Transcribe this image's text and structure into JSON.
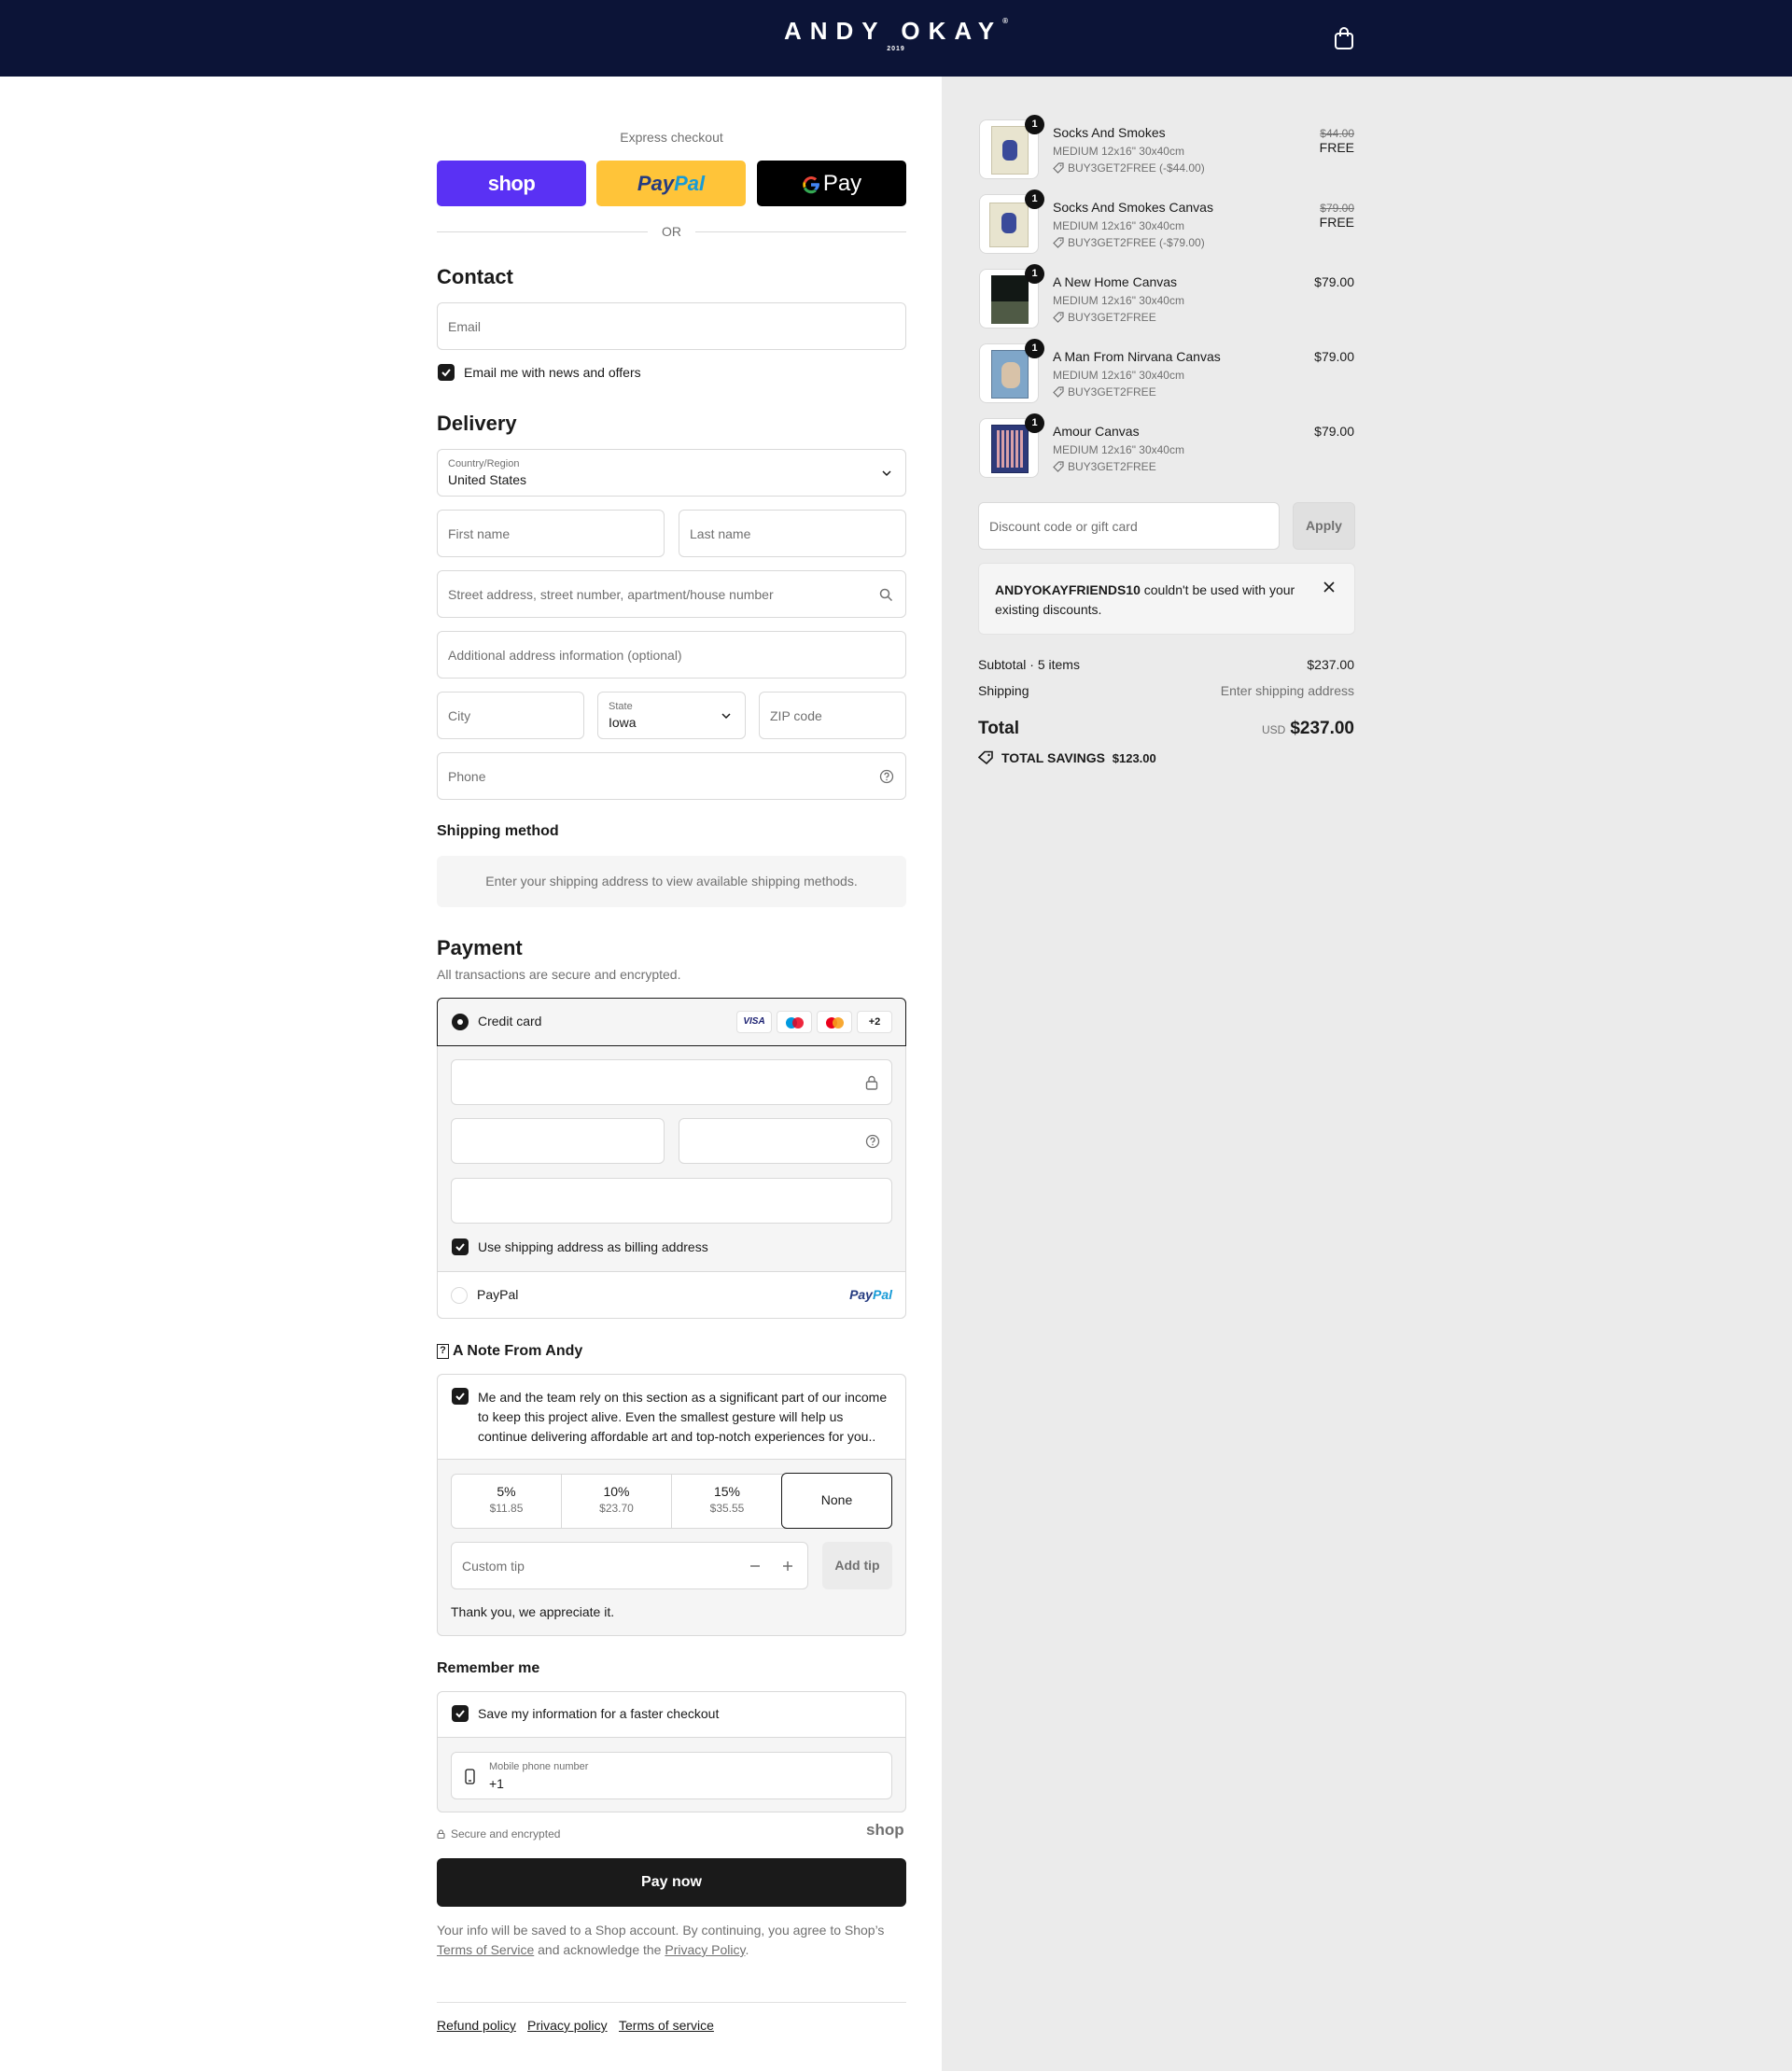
{
  "header": {
    "brand": "ANDY OKAY",
    "reg": "®",
    "year": "2019"
  },
  "express": {
    "label": "Express checkout",
    "shop": "shop",
    "paypal_a": "Pay",
    "paypal_b": "Pal",
    "gpay": "Pay",
    "or": "OR"
  },
  "contact": {
    "title": "Contact",
    "email_placeholder": "Email",
    "news_label": "Email me with news and offers"
  },
  "delivery": {
    "title": "Delivery",
    "country_label": "Country/Region",
    "country_value": "United States",
    "first_name": "First name",
    "last_name": "Last name",
    "street": "Street address, street number, apartment/house number",
    "additional": "Additional address information (optional)",
    "city": "City",
    "state_label": "State",
    "state_value": "Iowa",
    "zip": "ZIP code",
    "phone": "Phone"
  },
  "shipping": {
    "title": "Shipping method",
    "notice": "Enter your shipping address to view available shipping methods."
  },
  "payment": {
    "title": "Payment",
    "subtitle": "All transactions are secure and encrypted.",
    "credit_card": "Credit card",
    "visa": "VISA",
    "more": "+2",
    "billing_label": "Use shipping address as billing address",
    "paypal": "PayPal",
    "paypal_logo_a": "Pay",
    "paypal_logo_b": "Pal"
  },
  "note": {
    "title": "A Note From Andy",
    "text": "Me and the team rely on this section as a significant part of our income to keep this project alive. Even the smallest gesture will help us continue delivering affordable art and top-notch experiences for you..",
    "tips": [
      {
        "pct": "5%",
        "amt": "$11.85"
      },
      {
        "pct": "10%",
        "amt": "$23.70"
      },
      {
        "pct": "15%",
        "amt": "$35.55"
      }
    ],
    "none": "None",
    "custom_placeholder": "Custom tip",
    "add_tip": "Add tip",
    "thanks": "Thank you, we appreciate it."
  },
  "remember": {
    "title": "Remember me",
    "save_label": "Save my information for a faster checkout",
    "mobile_label": "Mobile phone number",
    "mobile_value": "+1",
    "secure": "Secure and encrypted",
    "shop": "shop"
  },
  "pay_now": "Pay now",
  "legal": {
    "text_a": "Your info will be saved to a Shop account. By continuing, you agree to Shop’s",
    "terms": "Terms of Service",
    "text_b": "and acknowledge the",
    "privacy": "Privacy Policy",
    "dot": "."
  },
  "footer": {
    "refund": "Refund policy",
    "privacy": "Privacy policy",
    "terms": "Terms of service"
  },
  "cart": {
    "items": [
      {
        "name": "Socks And Smokes",
        "variant": "MEDIUM 12x16\" 30x40cm",
        "discount": "BUY3GET2FREE (-$44.00)",
        "orig": "$44.00",
        "price": "FREE",
        "qty": "1"
      },
      {
        "name": "Socks And Smokes Canvas",
        "variant": "MEDIUM 12x16\" 30x40cm",
        "discount": "BUY3GET2FREE (-$79.00)",
        "orig": "$79.00",
        "price": "FREE",
        "qty": "1"
      },
      {
        "name": "A New Home Canvas",
        "variant": "MEDIUM 12x16\" 30x40cm",
        "discount": "BUY3GET2FREE",
        "price": "$79.00",
        "qty": "1"
      },
      {
        "name": "A Man From Nirvana Canvas",
        "variant": "MEDIUM 12x16\" 30x40cm",
        "discount": "BUY3GET2FREE",
        "price": "$79.00",
        "qty": "1"
      },
      {
        "name": "Amour Canvas",
        "variant": "MEDIUM 12x16\" 30x40cm",
        "discount": "BUY3GET2FREE",
        "price": "$79.00",
        "qty": "1"
      }
    ],
    "discount_placeholder": "Discount code or gift card",
    "apply": "Apply",
    "error_code": "ANDYOKAYFRIENDS10",
    "error_text": " couldn't be used with your existing discounts.",
    "subtotal_label": "Subtotal · 5 items",
    "subtotal": "$237.00",
    "shipping_label": "Shipping",
    "shipping_value": "Enter shipping address",
    "total_label": "Total",
    "currency": "USD",
    "total": "$237.00",
    "savings_label": "TOTAL SAVINGS",
    "savings": "$123.00"
  }
}
